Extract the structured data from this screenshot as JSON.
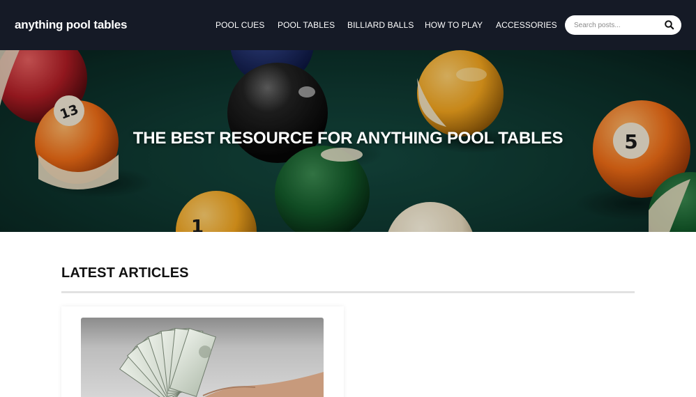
{
  "header": {
    "logo": "anything pool tables",
    "nav": [
      {
        "label": "POOL CUES"
      },
      {
        "label": "POOL TABLES"
      },
      {
        "label": "BILLIARD BALLS"
      },
      {
        "label": "HOW TO PLAY"
      },
      {
        "label": "ACCESSORIES"
      }
    ],
    "search": {
      "placeholder": "Search posts...",
      "icon": "search-icon"
    }
  },
  "hero": {
    "title": "THE BEST RESOURCE FOR ANYTHING POOL TABLES",
    "balls": [
      {
        "number": "13",
        "color": "#f07a1a"
      },
      {
        "number": "5",
        "color": "#f06a14"
      },
      {
        "number": "1",
        "color": "#f3a51e"
      }
    ]
  },
  "latest": {
    "title": "LATEST ARTICLES"
  }
}
